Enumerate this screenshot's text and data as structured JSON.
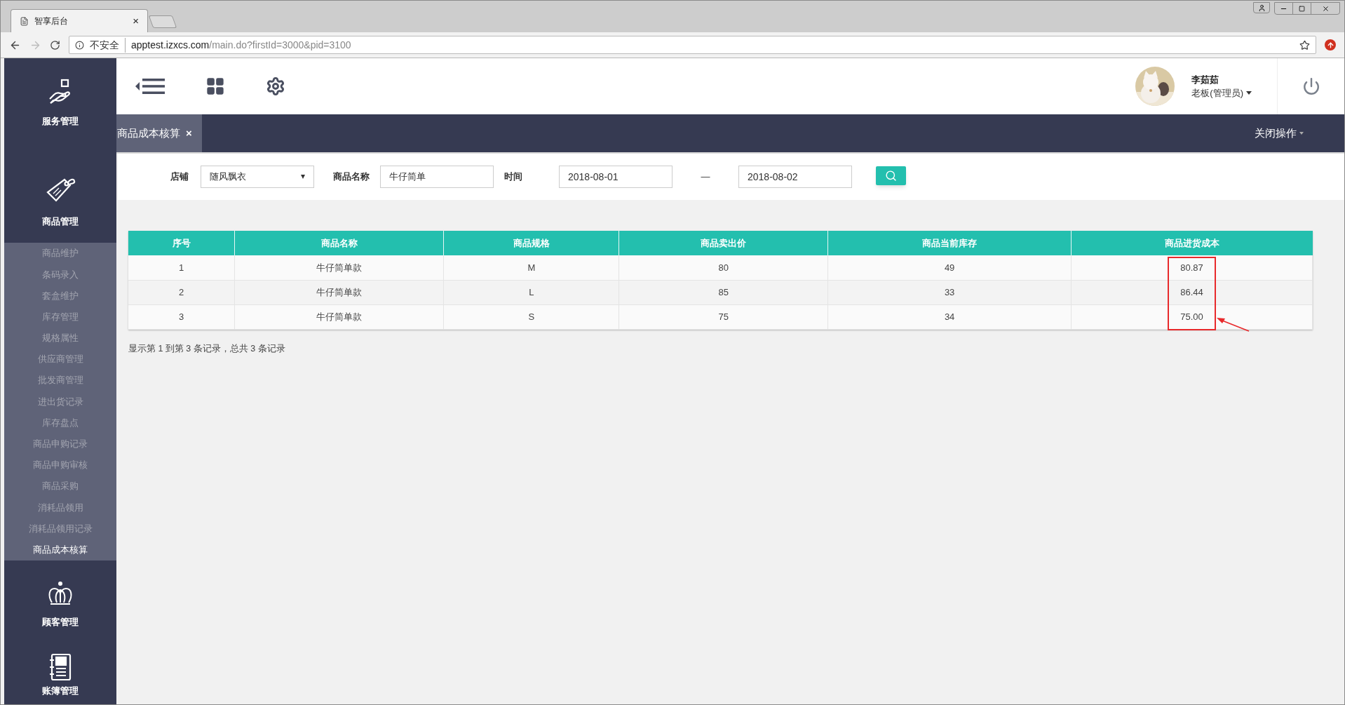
{
  "browser": {
    "tab_title": "智享后台",
    "tab_close": "×",
    "security": "不安全",
    "url_host": "apptest.izxcs.com",
    "url_path": "/main.do?firstId=3000&pid=3100"
  },
  "sidebar": {
    "sections": [
      {
        "label": "服务管理",
        "kind": "hand"
      },
      {
        "label": "商品管理",
        "kind": "tag",
        "children": [
          {
            "label": "商品维护",
            "selected": false
          },
          {
            "label": "条码录入",
            "selected": false
          },
          {
            "label": "套盒维护",
            "selected": false
          },
          {
            "label": "库存管理",
            "selected": false
          },
          {
            "label": "规格属性",
            "selected": false
          },
          {
            "label": "供应商管理",
            "selected": false
          },
          {
            "label": "批发商管理",
            "selected": false
          },
          {
            "label": "进出货记录",
            "selected": false
          },
          {
            "label": "库存盘点",
            "selected": false
          },
          {
            "label": "商品申购记录",
            "selected": false
          },
          {
            "label": "商品申购审核",
            "selected": false
          },
          {
            "label": "商品采购",
            "selected": false
          },
          {
            "label": "消耗品领用",
            "selected": false
          },
          {
            "label": "消耗品领用记录",
            "selected": false
          },
          {
            "label": "商品成本核算",
            "selected": true
          }
        ]
      },
      {
        "label": "顾客管理",
        "kind": "crown"
      },
      {
        "label": "账簿管理",
        "kind": "ledger"
      }
    ]
  },
  "header": {
    "user_name": "李茹茹",
    "user_role": "老板(管理员)"
  },
  "tabs": [
    {
      "label": "商品成本核算",
      "close": "×",
      "selected": true
    }
  ],
  "close_ops": "关闭操作",
  "filter": {
    "store_label": "店铺",
    "store_value": "随风飘衣",
    "name_label": "商品名称",
    "name_value": "牛仔简单",
    "time_label": "时间",
    "date_from": "2018-08-01",
    "separator": "—",
    "date_to": "2018-08-02"
  },
  "table": {
    "columns": [
      {
        "label": "序号",
        "highlighted": false
      },
      {
        "label": "商品名称",
        "highlighted": false
      },
      {
        "label": "商品规格",
        "highlighted": false
      },
      {
        "label": "商品卖出价",
        "highlighted": false
      },
      {
        "label": "商品当前库存",
        "highlighted": false
      },
      {
        "label": "商品进货成本",
        "highlighted": true
      }
    ],
    "rows": [
      [
        "1",
        "牛仔简单款",
        "M",
        "80",
        "49",
        "80.87"
      ],
      [
        "2",
        "牛仔简单款",
        "L",
        "85",
        "33",
        "86.44"
      ],
      [
        "3",
        "牛仔简单款",
        "S",
        "75",
        "34",
        "75.00"
      ]
    ]
  },
  "pagination": "显示第 1 到第 3 条记录，总共 3 条记录"
}
